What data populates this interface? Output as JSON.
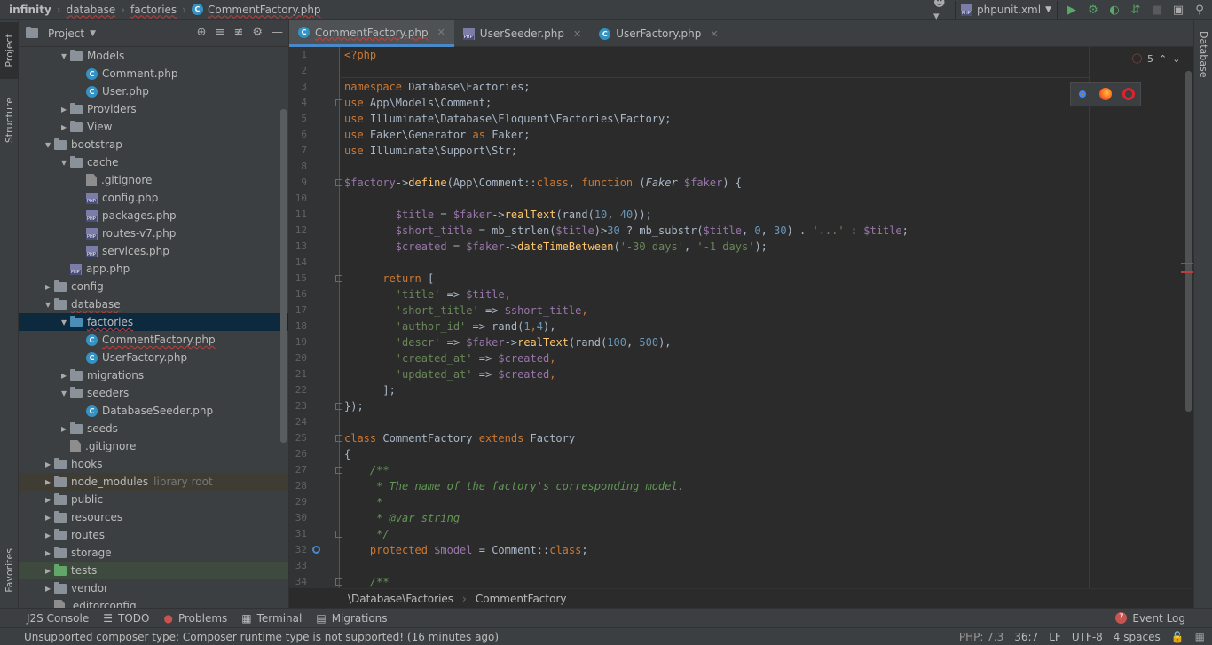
{
  "navbar": {
    "crumbs": [
      "infinity",
      "database",
      "factories",
      "CommentFactory.php"
    ],
    "run_config": "phpunit.xml"
  },
  "left_strip": {
    "project": "Project",
    "structure": "Structure",
    "favorites": "Favorites"
  },
  "right_strip": {
    "database": "Database"
  },
  "project_panel": {
    "title": "Project",
    "tree": [
      {
        "label": "Models",
        "type": "folder",
        "depth": 2,
        "expanded": true
      },
      {
        "label": "Comment.php",
        "type": "class",
        "depth": 3
      },
      {
        "label": "User.php",
        "type": "class",
        "depth": 3
      },
      {
        "label": "Providers",
        "type": "folder",
        "depth": 2,
        "expanded": false
      },
      {
        "label": "View",
        "type": "folder",
        "depth": 2,
        "expanded": false
      },
      {
        "label": "bootstrap",
        "type": "folder",
        "depth": 1,
        "expanded": true
      },
      {
        "label": "cache",
        "type": "folder",
        "depth": 2,
        "expanded": true
      },
      {
        "label": ".gitignore",
        "type": "file",
        "depth": 3
      },
      {
        "label": "config.php",
        "type": "php",
        "depth": 3
      },
      {
        "label": "packages.php",
        "type": "php",
        "depth": 3
      },
      {
        "label": "routes-v7.php",
        "type": "php",
        "depth": 3
      },
      {
        "label": "services.php",
        "type": "php",
        "depth": 3
      },
      {
        "label": "app.php",
        "type": "php",
        "depth": 2
      },
      {
        "label": "config",
        "type": "folder",
        "depth": 1,
        "expanded": false
      },
      {
        "label": "database",
        "type": "folder",
        "depth": 1,
        "expanded": true,
        "squiggle": true
      },
      {
        "label": "factories",
        "type": "folder-blue",
        "depth": 2,
        "expanded": true,
        "selected": true,
        "squiggle": true
      },
      {
        "label": "CommentFactory.php",
        "type": "class",
        "depth": 3,
        "squiggle": true
      },
      {
        "label": "UserFactory.php",
        "type": "class",
        "depth": 3
      },
      {
        "label": "migrations",
        "type": "folder",
        "depth": 2,
        "expanded": false
      },
      {
        "label": "seeders",
        "type": "folder",
        "depth": 2,
        "expanded": true
      },
      {
        "label": "DatabaseSeeder.php",
        "type": "class",
        "depth": 3
      },
      {
        "label": "seeds",
        "type": "folder",
        "depth": 2,
        "expanded": false
      },
      {
        "label": ".gitignore",
        "type": "file",
        "depth": 2
      },
      {
        "label": "hooks",
        "type": "folder",
        "depth": 1,
        "expanded": false
      },
      {
        "label": "node_modules",
        "type": "folder",
        "depth": 1,
        "expanded": false,
        "note": "library root",
        "lib": true
      },
      {
        "label": "public",
        "type": "folder",
        "depth": 1,
        "expanded": false
      },
      {
        "label": "resources",
        "type": "folder",
        "depth": 1,
        "expanded": false
      },
      {
        "label": "routes",
        "type": "folder",
        "depth": 1,
        "expanded": false
      },
      {
        "label": "storage",
        "type": "folder",
        "depth": 1,
        "expanded": false
      },
      {
        "label": "tests",
        "type": "folder-green",
        "depth": 1,
        "expanded": false,
        "test": true
      },
      {
        "label": "vendor",
        "type": "folder",
        "depth": 1,
        "expanded": false
      },
      {
        "label": ".editorconfig",
        "type": "file",
        "depth": 1
      }
    ]
  },
  "editor_tabs": [
    {
      "label": "CommentFactory.php",
      "type": "class",
      "active": true
    },
    {
      "label": "UserSeeder.php",
      "type": "php",
      "active": false
    },
    {
      "label": "UserFactory.php",
      "type": "class",
      "active": false
    }
  ],
  "editor": {
    "error_count": "5",
    "lines": [
      [
        [
          "kw",
          "<?php"
        ]
      ],
      [],
      [
        [
          "kw",
          "namespace "
        ],
        [
          "",
          "Database\\Factories;"
        ]
      ],
      [
        [
          "kw",
          "use "
        ],
        [
          "",
          "App\\Models\\Comment;"
        ]
      ],
      [
        [
          "kw",
          "use "
        ],
        [
          "",
          "Illuminate\\Database\\Eloquent\\Factories\\Factory;"
        ]
      ],
      [
        [
          "kw",
          "use "
        ],
        [
          "",
          "Faker\\Generator "
        ],
        [
          "kw",
          "as "
        ],
        [
          "",
          "Faker;"
        ]
      ],
      [
        [
          "kw",
          "use "
        ],
        [
          "",
          "Illuminate\\Support\\Str;"
        ]
      ],
      [],
      [
        [
          "vr",
          "$factory"
        ],
        [
          "",
          "->"
        ],
        [
          "fn",
          "define"
        ],
        [
          "",
          "(App\\Comment::"
        ],
        [
          "kw",
          "class"
        ],
        [
          "",
          ", "
        ],
        [
          "kw",
          "function "
        ],
        [
          "",
          "("
        ],
        [
          "it",
          "Faker "
        ],
        [
          "vr",
          "$faker"
        ],
        [
          "",
          ") {"
        ]
      ],
      [],
      [
        [
          "",
          "        "
        ],
        [
          "vr",
          "$title"
        ],
        [
          "",
          " = "
        ],
        [
          "vr",
          "$faker"
        ],
        [
          "",
          "->"
        ],
        [
          "fn",
          "realText"
        ],
        [
          "",
          "(rand("
        ],
        [
          "nu",
          "10"
        ],
        [
          "",
          ", "
        ],
        [
          "nu",
          "40"
        ],
        [
          "",
          "));"
        ]
      ],
      [
        [
          "",
          "        "
        ],
        [
          "vr",
          "$short_title"
        ],
        [
          "",
          " = mb_strlen("
        ],
        [
          "vr",
          "$title"
        ],
        [
          "",
          ")>"
        ],
        [
          "nu",
          "30"
        ],
        [
          "",
          " ? mb_substr("
        ],
        [
          "vr",
          "$title"
        ],
        [
          "",
          ", "
        ],
        [
          "nu",
          "0"
        ],
        [
          "",
          ", "
        ],
        [
          "nu",
          "30"
        ],
        [
          "",
          ") . "
        ],
        [
          "st",
          "'...'"
        ],
        [
          "",
          " : "
        ],
        [
          "vr",
          "$title"
        ],
        [
          "",
          ";"
        ]
      ],
      [
        [
          "",
          "        "
        ],
        [
          "vr",
          "$created"
        ],
        [
          "",
          " = "
        ],
        [
          "vr",
          "$faker"
        ],
        [
          "",
          "->"
        ],
        [
          "fn",
          "dateTimeBetween"
        ],
        [
          "",
          "("
        ],
        [
          "st",
          "'-30 days'"
        ],
        [
          "",
          ", "
        ],
        [
          "st",
          "'-1 days'"
        ],
        [
          "",
          ");"
        ]
      ],
      [],
      [
        [
          "",
          "      "
        ],
        [
          "kw",
          "return "
        ],
        [
          "",
          "["
        ]
      ],
      [
        [
          "",
          "        "
        ],
        [
          "st",
          "'title'"
        ],
        [
          "",
          " => "
        ],
        [
          "vr",
          "$title"
        ],
        [
          "kw",
          ","
        ]
      ],
      [
        [
          "",
          "        "
        ],
        [
          "st",
          "'short_title'"
        ],
        [
          "",
          " => "
        ],
        [
          "vr",
          "$short_title"
        ],
        [
          "kw",
          ","
        ]
      ],
      [
        [
          "",
          "        "
        ],
        [
          "st",
          "'author_id'"
        ],
        [
          "",
          " => rand("
        ],
        [
          "nu",
          "1"
        ],
        [
          "kw",
          ","
        ],
        [
          "nu",
          "4"
        ],
        [
          "",
          "),"
        ]
      ],
      [
        [
          "",
          "        "
        ],
        [
          "st",
          "'descr'"
        ],
        [
          "",
          " => "
        ],
        [
          "vr",
          "$faker"
        ],
        [
          "",
          "->"
        ],
        [
          "fn",
          "realText"
        ],
        [
          "",
          "(rand("
        ],
        [
          "nu",
          "100"
        ],
        [
          "",
          ", "
        ],
        [
          "nu",
          "500"
        ],
        [
          "",
          "),"
        ]
      ],
      [
        [
          "",
          "        "
        ],
        [
          "st",
          "'created_at'"
        ],
        [
          "",
          " => "
        ],
        [
          "vr",
          "$created"
        ],
        [
          "kw",
          ","
        ]
      ],
      [
        [
          "",
          "        "
        ],
        [
          "st",
          "'updated_at'"
        ],
        [
          "",
          " => "
        ],
        [
          "vr",
          "$created"
        ],
        [
          "kw",
          ","
        ]
      ],
      [
        [
          "",
          "      "
        ],
        [
          "",
          "];"
        ]
      ],
      [
        [
          "",
          "});"
        ]
      ],
      [],
      [
        [
          "kw",
          "class "
        ],
        [
          "",
          "CommentFactory "
        ],
        [
          "kw",
          "extends "
        ],
        [
          "",
          "Factory"
        ]
      ],
      [
        [
          "",
          "{"
        ]
      ],
      [
        [
          "",
          "    "
        ],
        [
          "cm",
          "/**"
        ]
      ],
      [
        [
          "",
          "    "
        ],
        [
          "cm",
          " * The name of the factory's corresponding model."
        ]
      ],
      [
        [
          "",
          "    "
        ],
        [
          "cm",
          " *"
        ]
      ],
      [
        [
          "",
          "    "
        ],
        [
          "cm",
          " * @var string"
        ]
      ],
      [
        [
          "",
          "    "
        ],
        [
          "cm",
          " */"
        ]
      ],
      [
        [
          "",
          "    "
        ],
        [
          "kw",
          "protected "
        ],
        [
          "vr",
          "$model"
        ],
        [
          "",
          " = Comment::"
        ],
        [
          "kw",
          "class"
        ],
        [
          "",
          ";"
        ]
      ],
      [],
      [
        [
          "",
          "    "
        ],
        [
          "cm",
          "/**"
        ]
      ]
    ]
  },
  "editor_breadcrumb": [
    "\\Database\\Factories",
    "CommentFactory"
  ],
  "tool_windows": {
    "j2s": "J2S Console",
    "todo": "TODO",
    "problems": "Problems",
    "terminal": "Terminal",
    "migrations": "Migrations",
    "event_log": "Event Log",
    "event_count": "7"
  },
  "status_bar": {
    "message": "Unsupported composer type: Composer runtime type is not supported! (16 minutes ago)",
    "php": "PHP: 7.3",
    "position": "36:7",
    "line_sep": "LF",
    "encoding": "UTF-8",
    "indent": "4 spaces"
  },
  "colors": {
    "accent": "#4a88c7",
    "selection": "#0d293e",
    "error": "#bc3f3c"
  }
}
